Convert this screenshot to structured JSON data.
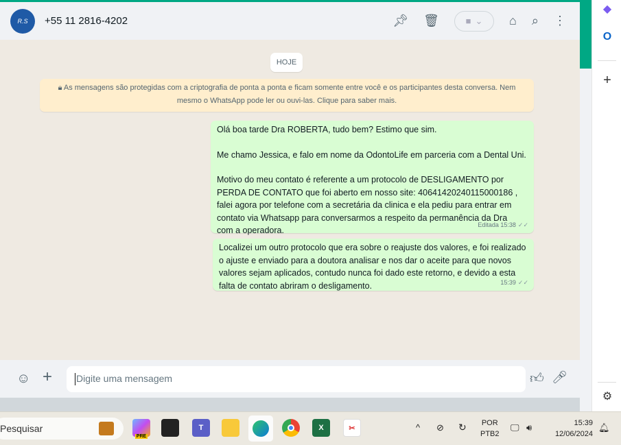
{
  "header": {
    "avatar_text": "R.S",
    "contact": "+55 11 2816-4202"
  },
  "chat": {
    "date_label": "HOJE",
    "encryption_notice": "As mensagens são protegidas com a criptografia de ponta a ponta e ficam somente entre você e os participantes desta conversa. Nem mesmo o WhatsApp pode ler ou ouvi-las. Clique para saber mais.",
    "messages": [
      {
        "paragraphs": [
          "Olá boa tarde Dra ROBERTA, tudo bem? Estimo que sim.",
          "Me chamo Jessica, e falo em nome da OdontoLife em parceria com a Dental Uni.",
          "Motivo do meu contato é referente a um protocolo de DESLIGAMENTO por PERDA DE CONTATO que foi aberto em nosso site: 40641420240115000186 , falei agora por telefone com a secretária da clinica e ela pediu para entrar em contato via Whatsapp para conversarmos a respeito da permanência da Dra com a operadora."
        ],
        "meta": "Editada 15:38",
        "status": "✓✓"
      },
      {
        "paragraphs": [
          "Localizei um outro protocolo que era sobre o reajuste dos valores, e foi realizado o ajuste e enviado para a doutora analisar e nos dar o aceite para que novos valores sejam aplicados, contudo nunca foi dado este retorno, e devido a esta falta de contato abriram o desligamento."
        ],
        "meta": "15:39",
        "status": "✓✓"
      }
    ]
  },
  "composer": {
    "placeholder": "Digite uma mensagem"
  },
  "taskbar": {
    "search_placeholder": "Pesquisar",
    "copilot_badge": "PRE",
    "language": "POR",
    "layout": "PTB2",
    "time": "15:39",
    "date": "12/06/2024"
  },
  "colors": {
    "accent": "#00a884",
    "bubble": "#d9fdd3",
    "notice": "#ffeecd"
  }
}
